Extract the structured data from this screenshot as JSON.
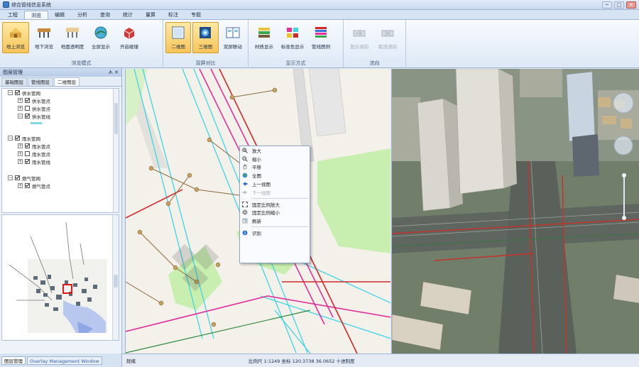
{
  "window": {
    "title": "综合管线信息系统",
    "min_label": "─",
    "max_label": "□",
    "close_label": "✕"
  },
  "menu": [
    "工程",
    "浏览",
    "编辑",
    "分析",
    "查询",
    "统计",
    "量算",
    "标注",
    "专题"
  ],
  "ribbon": {
    "groups": [
      {
        "label": "浏览模式",
        "buttons": [
          {
            "label": "地上浏览",
            "icon": "ground-view-icon",
            "active": true
          },
          {
            "label": "地下浏览",
            "icon": "underground-view-icon"
          },
          {
            "label": "地面透明度",
            "icon": "ground-transparency-icon"
          },
          {
            "label": "全屏显示",
            "icon": "fullscreen-icon"
          },
          {
            "label": "开启碰撞",
            "icon": "collision-icon"
          }
        ]
      },
      {
        "label": "双屏对比",
        "buttons": [
          {
            "label": "二维图",
            "icon": "2d-map-icon",
            "active": true
          },
          {
            "label": "三维图",
            "icon": "3d-map-icon",
            "active": true
          },
          {
            "label": "双屏联动",
            "icon": "dual-screen-link-icon"
          }
        ]
      },
      {
        "label": "显示方式",
        "buttons": [
          {
            "label": "材质显示",
            "icon": "material-display-icon"
          },
          {
            "label": "标准色显示",
            "icon": "standard-color-icon"
          },
          {
            "label": "管线图例",
            "icon": "pipeline-legend-icon"
          }
        ]
      },
      {
        "label": "流向",
        "buttons": [
          {
            "label": "显示流向",
            "icon": "show-flow-icon",
            "disabled": true
          },
          {
            "label": "取消流向",
            "icon": "cancel-flow-icon",
            "disabled": true
          }
        ]
      }
    ]
  },
  "left_panel": {
    "title": "图层管理",
    "pin": "ᗑ ✕",
    "tabs": [
      "基础图层",
      "管线图层",
      "二维图层"
    ],
    "tree": [
      {
        "label": "供水管网",
        "children": [
          {
            "label": "供水管点",
            "checked": true
          },
          {
            "label": "供水管点",
            "checked": false
          },
          {
            "label": "供水管线",
            "checked": true
          }
        ],
        "swatch": "#7fd8e6"
      },
      {
        "label": "雨水管网",
        "children": [
          {
            "label": "雨水管点",
            "checked": true
          },
          {
            "label": "雨水管点",
            "checked": false
          },
          {
            "label": "雨水管线",
            "checked": true
          }
        ],
        "swatch": null
      },
      {
        "label": "燃气管网",
        "children": [
          {
            "label": "燃气管点",
            "checked": true
          }
        ],
        "swatch": null
      }
    ]
  },
  "bottom_tabs": [
    "图层管理",
    "Overlay Management Window"
  ],
  "context_menu": {
    "items": [
      {
        "label": "放大",
        "icon": "zoom-in-icon"
      },
      {
        "label": "缩小",
        "icon": "zoom-out-icon"
      },
      {
        "label": "平移",
        "icon": "pan-icon"
      },
      {
        "label": "全图",
        "icon": "full-extent-icon"
      },
      {
        "label": "上一视图",
        "icon": "previous-view-icon"
      },
      {
        "label": "下一视图",
        "icon": "next-view-icon",
        "disabled": true
      },
      {
        "label": "固定比例放大",
        "icon": "fixed-zoom-in-icon",
        "sep_before": true
      },
      {
        "label": "固定比例缩小",
        "icon": "fixed-zoom-out-icon"
      },
      {
        "label": "刷新",
        "icon": "refresh-icon"
      },
      {
        "label": "识别",
        "icon": "identify-icon",
        "sep_before": true
      }
    ]
  },
  "status": {
    "left": "就绪",
    "right": "比例尺 1:1249   坐标 120.3738 36.0652 十进制度"
  },
  "colors": {
    "water_supply": "#3fd3e6",
    "rain": "#e0309c",
    "sewage": "#d02828",
    "green_space": "#c8eeb0",
    "accent": "#f7c45a"
  }
}
